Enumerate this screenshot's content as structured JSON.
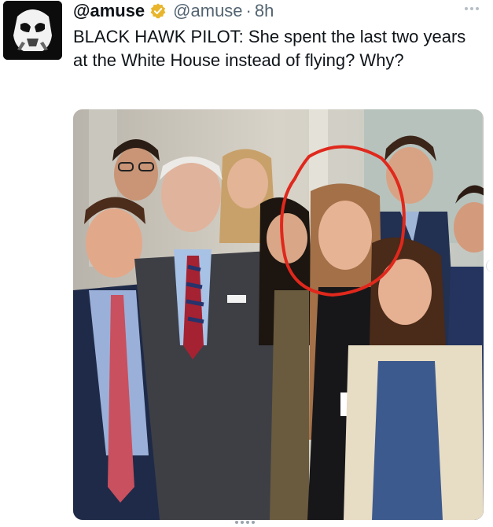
{
  "tweet": {
    "display_name": "@amuse",
    "handle": "@amuse",
    "separator": "·",
    "time": "8h",
    "verified": true,
    "avatar_icon": "stormtrooper-avatar",
    "text": "BLACK HAWK PILOT: She spent the last two years at the White House instead of flying? Why?",
    "more_icon": "more-options-icon"
  },
  "media": {
    "type": "photo",
    "annotation": "red-hand-drawn-circle",
    "annotation_color": "#e0281c"
  },
  "colors": {
    "text": "#0f1419",
    "secondary": "#536471",
    "verified_badge": "#e8b52c"
  }
}
